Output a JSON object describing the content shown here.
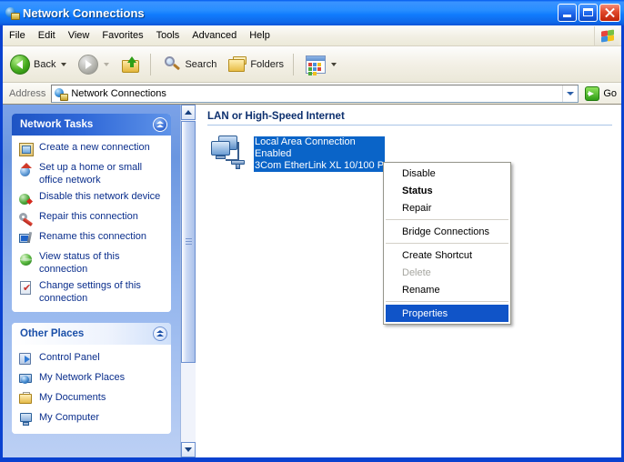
{
  "window": {
    "title": "Network Connections",
    "title_icon": "network-globe-icon",
    "buttons": {
      "minimize": "Minimize",
      "maximize": "Maximize",
      "close": "Close"
    }
  },
  "menubar": {
    "items": [
      {
        "label": "File"
      },
      {
        "label": "Edit"
      },
      {
        "label": "View"
      },
      {
        "label": "Favorites"
      },
      {
        "label": "Tools"
      },
      {
        "label": "Advanced"
      },
      {
        "label": "Help"
      }
    ],
    "brand_icon": "windows-flag-icon"
  },
  "toolbar": {
    "back_label": "Back",
    "back_icon": "back-arrow-icon",
    "forward_icon": "forward-arrow-icon",
    "up_icon": "up-one-level-icon",
    "search_label": "Search",
    "search_icon": "magnifier-icon",
    "folders_label": "Folders",
    "folders_icon": "folder-icon",
    "views_icon": "views-icon"
  },
  "address": {
    "label": "Address",
    "value": "Network Connections",
    "icon": "network-globe-icon",
    "dropdown_icon": "chevron-down-icon",
    "go_label": "Go",
    "go_icon": "go-arrow-icon"
  },
  "sidebar": {
    "scrollbar": {
      "up_icon": "scroll-up-icon",
      "down_icon": "scroll-down-icon"
    },
    "panels": [
      {
        "title": "Network Tasks",
        "collapse_icon": "chevron-up-circle-icon",
        "items": [
          {
            "label": "Create a new connection",
            "icon": "new-connection-icon"
          },
          {
            "label": "Set up a home or small office network",
            "icon": "home-network-icon"
          },
          {
            "label": "Disable this network device",
            "icon": "disable-device-icon"
          },
          {
            "label": "Repair this connection",
            "icon": "repair-icon"
          },
          {
            "label": "Rename this connection",
            "icon": "rename-icon"
          },
          {
            "label": "View status of this connection",
            "icon": "status-globe-icon"
          },
          {
            "label": "Change settings of this connection",
            "icon": "settings-page-icon"
          }
        ]
      },
      {
        "title": "Other Places",
        "collapse_icon": "chevron-up-circle-icon",
        "items": [
          {
            "label": "Control Panel",
            "icon": "control-panel-icon"
          },
          {
            "label": "My Network Places",
            "icon": "my-network-places-icon"
          },
          {
            "label": "My Documents",
            "icon": "my-documents-icon"
          },
          {
            "label": "My Computer",
            "icon": "my-computer-icon"
          }
        ]
      }
    ]
  },
  "content": {
    "group_header": "LAN or High-Speed Internet",
    "connection": {
      "icon": "lan-connection-icon",
      "name": "Local Area Connection",
      "status": "Enabled",
      "device": "3Com EtherLink XL 10/100 P"
    }
  },
  "context_menu": {
    "items": [
      {
        "label": "Disable",
        "state": "normal"
      },
      {
        "label": "Status",
        "state": "bold"
      },
      {
        "label": "Repair",
        "state": "normal"
      },
      {
        "separator": true
      },
      {
        "label": "Bridge Connections",
        "state": "normal"
      },
      {
        "separator": true
      },
      {
        "label": "Create Shortcut",
        "state": "normal"
      },
      {
        "label": "Delete",
        "state": "disabled"
      },
      {
        "label": "Rename",
        "state": "normal"
      },
      {
        "separator": true
      },
      {
        "label": "Properties",
        "state": "selected"
      }
    ]
  },
  "colors": {
    "titlebar_blue": "#0a53d8",
    "selection_blue": "#1054c8",
    "sidebar_blue": "#7ea4e8",
    "panel_header_blue": "#1e54c4",
    "link_text": "#0a2e8c",
    "group_header_text": "#0c2f6e"
  }
}
